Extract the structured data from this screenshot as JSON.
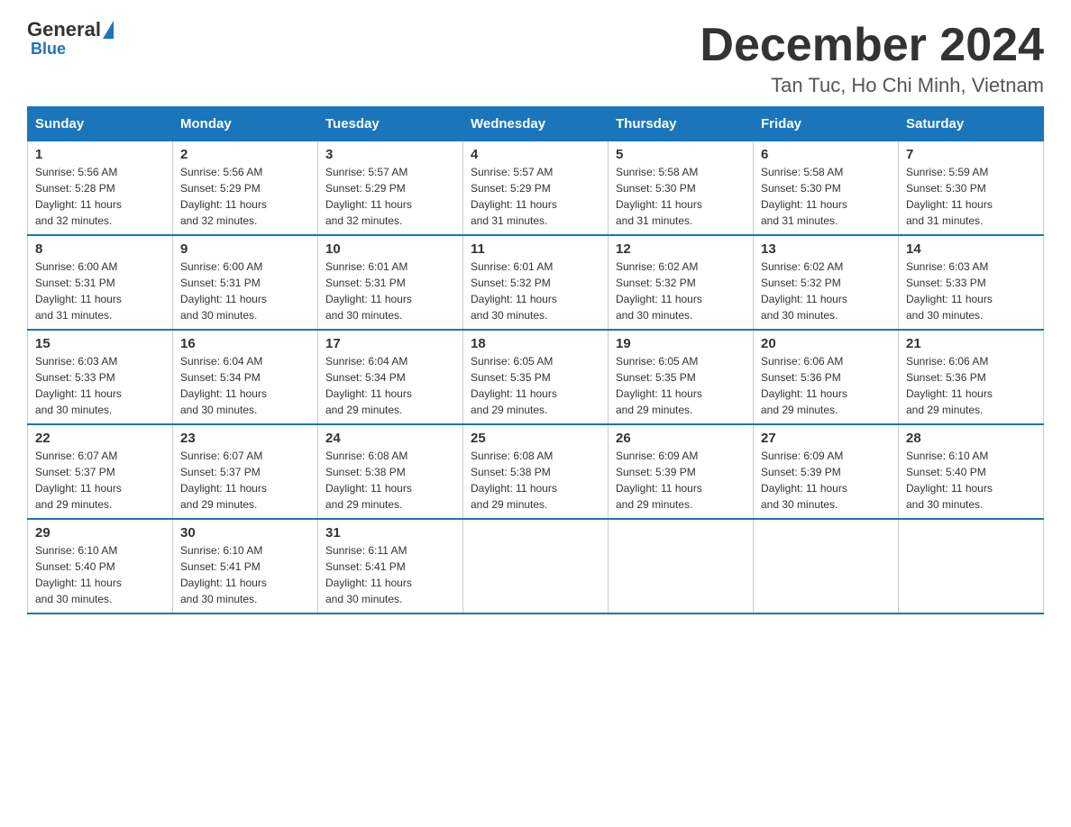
{
  "header": {
    "logo_general": "General",
    "logo_blue": "Blue",
    "month_title": "December 2024",
    "location": "Tan Tuc, Ho Chi Minh, Vietnam"
  },
  "days_of_week": [
    "Sunday",
    "Monday",
    "Tuesday",
    "Wednesday",
    "Thursday",
    "Friday",
    "Saturday"
  ],
  "weeks": [
    [
      {
        "day": "1",
        "sunrise": "5:56 AM",
        "sunset": "5:28 PM",
        "daylight": "11 hours and 32 minutes."
      },
      {
        "day": "2",
        "sunrise": "5:56 AM",
        "sunset": "5:29 PM",
        "daylight": "11 hours and 32 minutes."
      },
      {
        "day": "3",
        "sunrise": "5:57 AM",
        "sunset": "5:29 PM",
        "daylight": "11 hours and 32 minutes."
      },
      {
        "day": "4",
        "sunrise": "5:57 AM",
        "sunset": "5:29 PM",
        "daylight": "11 hours and 31 minutes."
      },
      {
        "day": "5",
        "sunrise": "5:58 AM",
        "sunset": "5:30 PM",
        "daylight": "11 hours and 31 minutes."
      },
      {
        "day": "6",
        "sunrise": "5:58 AM",
        "sunset": "5:30 PM",
        "daylight": "11 hours and 31 minutes."
      },
      {
        "day": "7",
        "sunrise": "5:59 AM",
        "sunset": "5:30 PM",
        "daylight": "11 hours and 31 minutes."
      }
    ],
    [
      {
        "day": "8",
        "sunrise": "6:00 AM",
        "sunset": "5:31 PM",
        "daylight": "11 hours and 31 minutes."
      },
      {
        "day": "9",
        "sunrise": "6:00 AM",
        "sunset": "5:31 PM",
        "daylight": "11 hours and 30 minutes."
      },
      {
        "day": "10",
        "sunrise": "6:01 AM",
        "sunset": "5:31 PM",
        "daylight": "11 hours and 30 minutes."
      },
      {
        "day": "11",
        "sunrise": "6:01 AM",
        "sunset": "5:32 PM",
        "daylight": "11 hours and 30 minutes."
      },
      {
        "day": "12",
        "sunrise": "6:02 AM",
        "sunset": "5:32 PM",
        "daylight": "11 hours and 30 minutes."
      },
      {
        "day": "13",
        "sunrise": "6:02 AM",
        "sunset": "5:32 PM",
        "daylight": "11 hours and 30 minutes."
      },
      {
        "day": "14",
        "sunrise": "6:03 AM",
        "sunset": "5:33 PM",
        "daylight": "11 hours and 30 minutes."
      }
    ],
    [
      {
        "day": "15",
        "sunrise": "6:03 AM",
        "sunset": "5:33 PM",
        "daylight": "11 hours and 30 minutes."
      },
      {
        "day": "16",
        "sunrise": "6:04 AM",
        "sunset": "5:34 PM",
        "daylight": "11 hours and 30 minutes."
      },
      {
        "day": "17",
        "sunrise": "6:04 AM",
        "sunset": "5:34 PM",
        "daylight": "11 hours and 29 minutes."
      },
      {
        "day": "18",
        "sunrise": "6:05 AM",
        "sunset": "5:35 PM",
        "daylight": "11 hours and 29 minutes."
      },
      {
        "day": "19",
        "sunrise": "6:05 AM",
        "sunset": "5:35 PM",
        "daylight": "11 hours and 29 minutes."
      },
      {
        "day": "20",
        "sunrise": "6:06 AM",
        "sunset": "5:36 PM",
        "daylight": "11 hours and 29 minutes."
      },
      {
        "day": "21",
        "sunrise": "6:06 AM",
        "sunset": "5:36 PM",
        "daylight": "11 hours and 29 minutes."
      }
    ],
    [
      {
        "day": "22",
        "sunrise": "6:07 AM",
        "sunset": "5:37 PM",
        "daylight": "11 hours and 29 minutes."
      },
      {
        "day": "23",
        "sunrise": "6:07 AM",
        "sunset": "5:37 PM",
        "daylight": "11 hours and 29 minutes."
      },
      {
        "day": "24",
        "sunrise": "6:08 AM",
        "sunset": "5:38 PM",
        "daylight": "11 hours and 29 minutes."
      },
      {
        "day": "25",
        "sunrise": "6:08 AM",
        "sunset": "5:38 PM",
        "daylight": "11 hours and 29 minutes."
      },
      {
        "day": "26",
        "sunrise": "6:09 AM",
        "sunset": "5:39 PM",
        "daylight": "11 hours and 29 minutes."
      },
      {
        "day": "27",
        "sunrise": "6:09 AM",
        "sunset": "5:39 PM",
        "daylight": "11 hours and 30 minutes."
      },
      {
        "day": "28",
        "sunrise": "6:10 AM",
        "sunset": "5:40 PM",
        "daylight": "11 hours and 30 minutes."
      }
    ],
    [
      {
        "day": "29",
        "sunrise": "6:10 AM",
        "sunset": "5:40 PM",
        "daylight": "11 hours and 30 minutes."
      },
      {
        "day": "30",
        "sunrise": "6:10 AM",
        "sunset": "5:41 PM",
        "daylight": "11 hours and 30 minutes."
      },
      {
        "day": "31",
        "sunrise": "6:11 AM",
        "sunset": "5:41 PM",
        "daylight": "11 hours and 30 minutes."
      },
      null,
      null,
      null,
      null
    ]
  ],
  "labels": {
    "sunrise": "Sunrise:",
    "sunset": "Sunset:",
    "daylight": "Daylight:"
  }
}
